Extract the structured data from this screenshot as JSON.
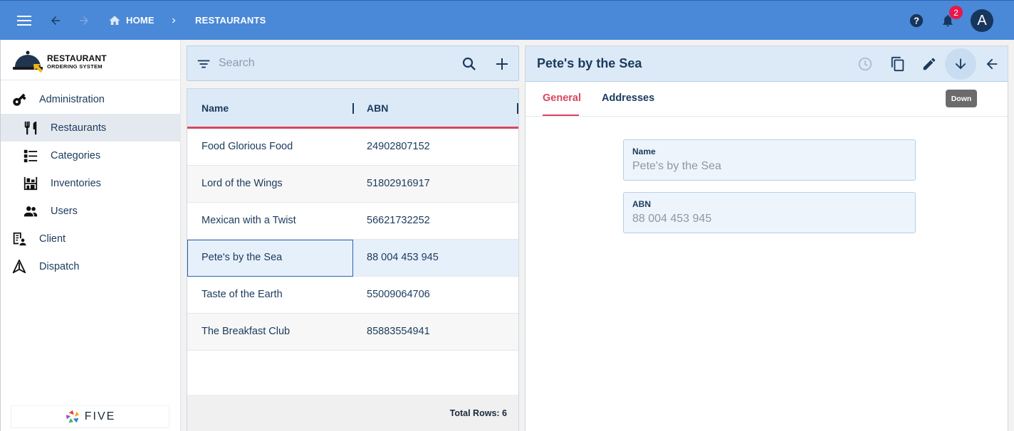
{
  "topbar": {
    "home_label": "HOME",
    "current_label": "RESTAURANTS",
    "notification_count": "2",
    "avatar_letter": "A"
  },
  "sidebar": {
    "logo_title": "RESTAURANT",
    "logo_subtitle": "ORDERING SYSTEM",
    "items": [
      {
        "label": "Administration",
        "icon": "key-icon"
      },
      {
        "label": "Restaurants",
        "icon": "cutlery-icon"
      },
      {
        "label": "Categories",
        "icon": "category-list-icon"
      },
      {
        "label": "Inventories",
        "icon": "shelf-icon"
      },
      {
        "label": "Users",
        "icon": "users-icon"
      },
      {
        "label": "Client",
        "icon": "client-icon"
      },
      {
        "label": "Dispatch",
        "icon": "dispatch-icon"
      }
    ],
    "brand": "FIVE"
  },
  "list": {
    "search_placeholder": "Search",
    "columns": [
      "Name",
      "ABN"
    ],
    "rows": [
      {
        "name": "Food Glorious Food",
        "abn": "24902807152"
      },
      {
        "name": "Lord of the Wings",
        "abn": "51802916917"
      },
      {
        "name": "Mexican with a Twist",
        "abn": "56621732252"
      },
      {
        "name": "Pete's by the Sea",
        "abn": "88 004 453 945"
      },
      {
        "name": "Taste of the Earth",
        "abn": "55009064706"
      },
      {
        "name": "The Breakfast Club",
        "abn": "85883554941"
      }
    ],
    "footer": "Total Rows: 6"
  },
  "detail": {
    "title": "Pete's by the Sea",
    "tooltip": "Down",
    "tabs": [
      "General",
      "Addresses"
    ],
    "fields": [
      {
        "label": "Name",
        "value": "Pete's by the Sea"
      },
      {
        "label": "ABN",
        "value": "88 004 453 945"
      }
    ]
  },
  "colors": {
    "topbar": "#4a88d8",
    "accent": "#d9465f",
    "panel_header": "#dce9f7",
    "text": "#1b3a5c"
  }
}
